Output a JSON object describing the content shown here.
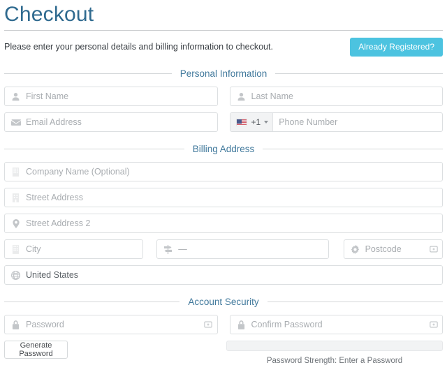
{
  "header": {
    "title": "Checkout",
    "subtitle": "Please enter your personal details and billing information to checkout.",
    "already_registered_label": "Already Registered?"
  },
  "sections": {
    "personal": "Personal Information",
    "billing": "Billing Address",
    "security": "Account Security"
  },
  "fields": {
    "first_name": "First Name",
    "last_name": "Last Name",
    "email": "Email Address",
    "phone_code": "+1",
    "phone": "Phone Number",
    "company": "Company Name (Optional)",
    "street1": "Street Address",
    "street2": "Street Address 2",
    "city": "City",
    "state": "—",
    "postcode": "Postcode",
    "country": "United States",
    "password": "Password",
    "confirm_password": "Confirm Password"
  },
  "security": {
    "generate_label": "Generate Password",
    "strength_label": "Password Strength: Enter a Password",
    "strength_percent": 0
  },
  "colors": {
    "accent": "#4cc3e0",
    "title": "#2f6a8f",
    "section_heading": "#41799c",
    "placeholder": "#a9adb1",
    "border": "#dcdfe1"
  }
}
